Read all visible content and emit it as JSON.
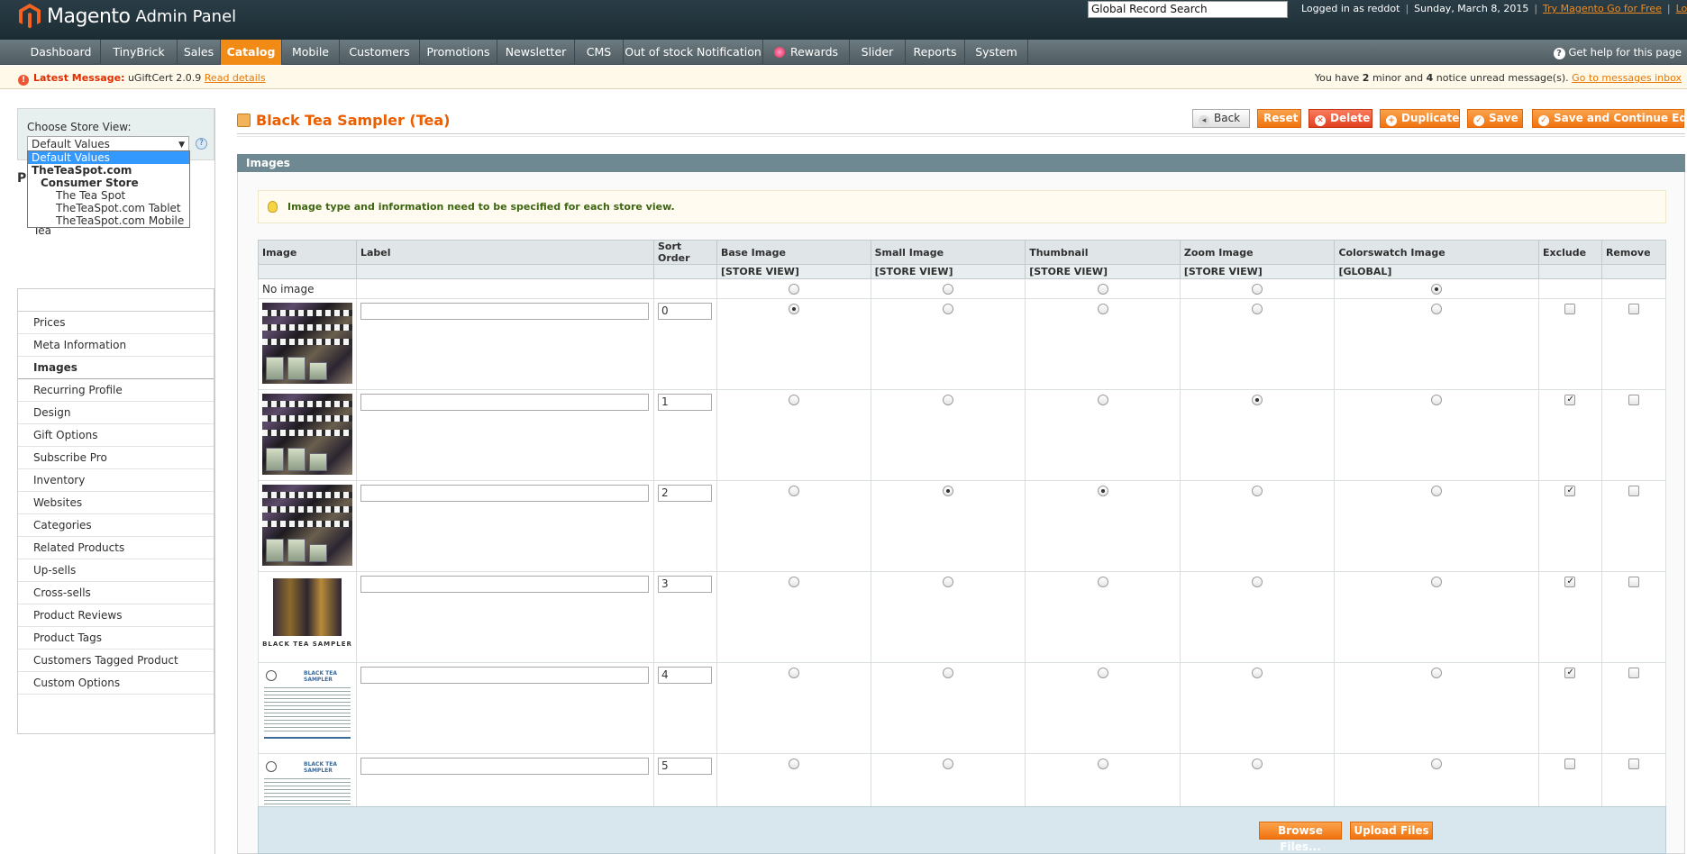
{
  "header": {
    "brand": "Magento",
    "brand_suffix": "Admin Panel",
    "search_value": "Global Record Search",
    "logged_in": "Logged in as reddot",
    "date": "Sunday, March 8, 2015",
    "try_link": "Try Magento Go for Free",
    "logout": "Log Out"
  },
  "nav": {
    "items": [
      "Dashboard",
      "TinyBrick",
      "Sales",
      "Catalog",
      "Mobile",
      "Customers",
      "Promotions",
      "Newsletter",
      "CMS",
      "Out of stock Notification",
      "Rewards",
      "Slider",
      "Reports",
      "System"
    ],
    "help": "Get help for this page"
  },
  "notice": {
    "label": "Latest Message:",
    "message": "uGiftCert 2.0.9",
    "read_details": "Read details",
    "summary_prefix": "You have",
    "minor_count": "2",
    "minor_text": "minor and",
    "notice_count": "4",
    "notice_text": "notice unread message(s).",
    "inbox_link": "Go to messages inbox"
  },
  "store": {
    "label": "Choose Store View:",
    "selected": "Default Values",
    "options": [
      "Default Values",
      "TheTeaSpot.com",
      "Consumer Store",
      "The Tea Spot",
      "TheTeaSpot.com Tablet",
      "TheTeaSpot.com Mobile"
    ]
  },
  "sidebar": {
    "heading_letter": "P",
    "partial_tab": "Tea",
    "tabs": [
      "Prices",
      "Meta Information",
      "Images",
      "Recurring Profile",
      "Design",
      "Gift Options",
      "Subscribe Pro",
      "Inventory",
      "Websites",
      "Categories",
      "Related Products",
      "Up-sells",
      "Cross-sells",
      "Product Reviews",
      "Product Tags",
      "Customers Tagged Product",
      "Custom Options"
    ]
  },
  "page": {
    "title": "Black Tea Sampler (Tea)",
    "buttons": {
      "back": "Back",
      "reset": "Reset",
      "delete": "Delete",
      "duplicate": "Duplicate",
      "save": "Save",
      "save_continue": "Save and Continue Edit"
    }
  },
  "images": {
    "section_title": "Images",
    "info": "Image type and information need to be specified for each store view.",
    "columns": [
      "Image",
      "Label",
      "Sort Order",
      "Base Image",
      "Small Image",
      "Thumbnail",
      "Zoom Image",
      "Colorswatch Image",
      "Exclude",
      "Remove"
    ],
    "scopes": [
      "[STORE VIEW]",
      "[STORE VIEW]",
      "[STORE VIEW]",
      "[STORE VIEW]",
      "[GLOBAL]"
    ],
    "no_image": "No image",
    "box_caption": "BLACK TEA SAMPLER",
    "doc_title": "BLACK TEA SAMPLER",
    "rows": [
      {
        "sort": "0",
        "base": true,
        "small": false,
        "thumb": false,
        "zoom": false,
        "swatch": false,
        "exclude": false,
        "remove": false
      },
      {
        "sort": "1",
        "base": false,
        "small": false,
        "thumb": false,
        "zoom": true,
        "swatch": false,
        "exclude": true,
        "remove": false
      },
      {
        "sort": "2",
        "base": false,
        "small": true,
        "thumb": true,
        "zoom": false,
        "swatch": false,
        "exclude": true,
        "remove": false
      },
      {
        "sort": "3",
        "base": false,
        "small": false,
        "thumb": false,
        "zoom": false,
        "swatch": false,
        "exclude": true,
        "remove": false
      },
      {
        "sort": "4",
        "base": false,
        "small": false,
        "thumb": false,
        "zoom": false,
        "swatch": false,
        "exclude": true,
        "remove": false
      },
      {
        "sort": "5",
        "base": false,
        "small": false,
        "thumb": false,
        "zoom": false,
        "swatch": false,
        "exclude": false,
        "remove": false
      }
    ],
    "browse": "Browse Files...",
    "upload": "Upload Files"
  }
}
